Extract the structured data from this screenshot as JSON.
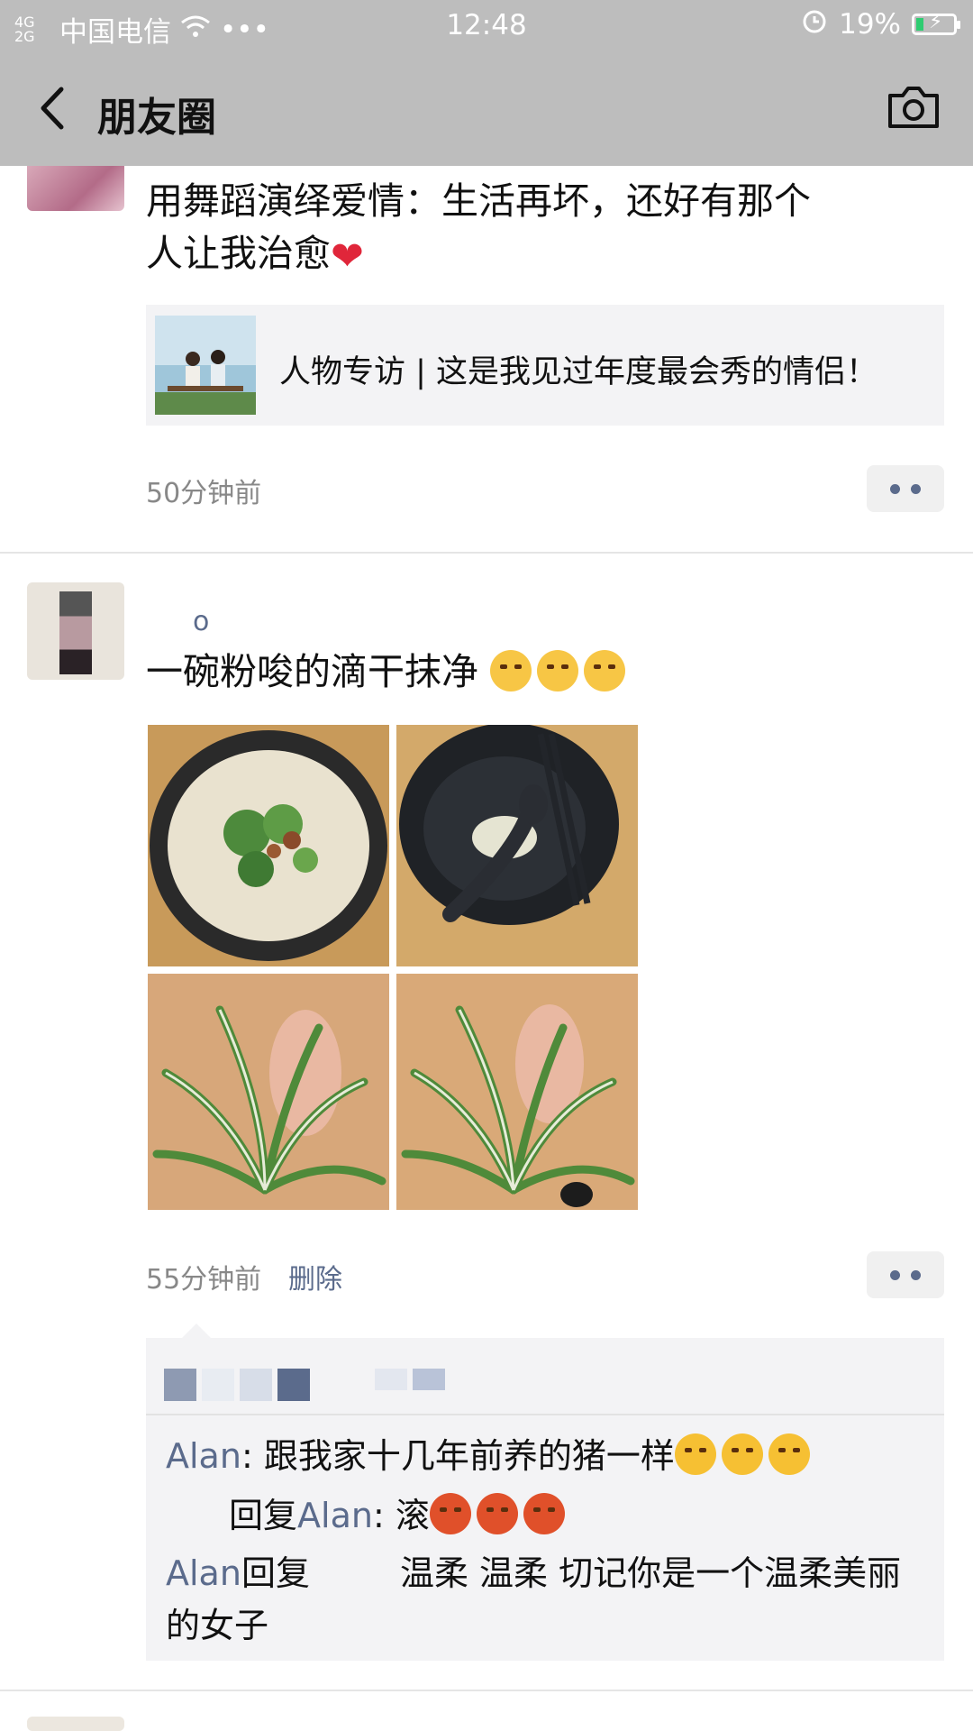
{
  "status_bar": {
    "network": "4G 2G",
    "carrier": "中国电信",
    "time": "12:48",
    "battery": "19%"
  },
  "nav": {
    "title": "朋友圈",
    "back_icon": "chevron-left-icon",
    "camera_icon": "camera-icon"
  },
  "posts": [
    {
      "text_line1": "用舞蹈演绎爱情：生活再坏，还好有那个",
      "text_line2": "人让我治愈",
      "link_title": "人物专访 | 这是我见过年度最会秀的情侣！",
      "time": "50分钟前"
    },
    {
      "author": "o",
      "text": "一碗粉唆的滴干抹净",
      "time": "55分钟前",
      "delete_label": "删除",
      "photos": [
        "noodle-bowl-photo",
        "empty-bowl-photo",
        "spider-plant-photo-1",
        "spider-plant-photo-2"
      ],
      "comments": [
        {
          "name": "Alan",
          "sep": ": ",
          "text": "跟我家十几年前养的猪一样"
        },
        {
          "prefix": "回复",
          "name": "Alan",
          "sep": ": ",
          "text": "滚"
        },
        {
          "name": "Alan",
          "prefix": "回复",
          "text": "温柔 温柔 切记你是一个温柔美丽的女子"
        }
      ]
    }
  ],
  "colors": {
    "bar_bg": "#bdbdbd",
    "link_blue": "#5b6b8c",
    "card_bg": "#f3f3f5"
  }
}
